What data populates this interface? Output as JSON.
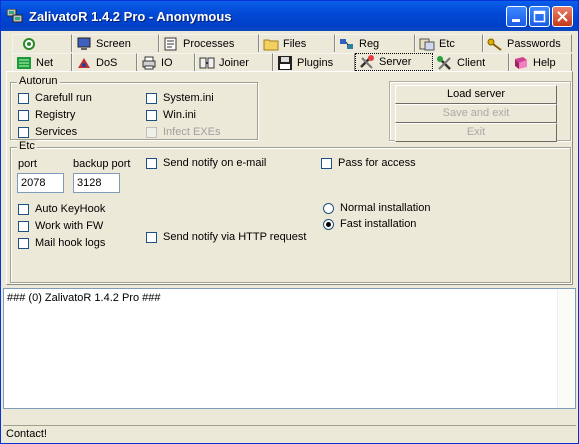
{
  "window": {
    "title": "ZalivatoR 1.4.2 Pro - Anonymous"
  },
  "tabs_row1": [
    {
      "label": "",
      "icon": "target-icon"
    },
    {
      "label": "Screen",
      "icon": "screen-icon"
    },
    {
      "label": "Processes",
      "icon": "processes-icon"
    },
    {
      "label": "Files",
      "icon": "folder-icon"
    },
    {
      "label": "Reg",
      "icon": "registry-icon"
    },
    {
      "label": "Etc",
      "icon": "etc-icon"
    },
    {
      "label": "Passwords",
      "icon": "keys-icon"
    }
  ],
  "tabs_row2": [
    {
      "label": "Net",
      "icon": "net-icon"
    },
    {
      "label": "DoS",
      "icon": "dos-icon"
    },
    {
      "label": "IO",
      "icon": "printer-icon"
    },
    {
      "label": "Joiner",
      "icon": "joiner-icon"
    },
    {
      "label": "Plugins",
      "icon": "floppy-icon"
    },
    {
      "label": "Server",
      "icon": "server-icon",
      "active": true
    },
    {
      "label": "Client",
      "icon": "client-icon"
    },
    {
      "label": "Help",
      "icon": "book-icon"
    }
  ],
  "autorun": {
    "legend": "Autorun",
    "carefull": "Carefull run",
    "registry": "Registry",
    "services": "Services",
    "system_ini": "System.ini",
    "win_ini": "Win.ini",
    "infect": "Infect EXEs"
  },
  "buttons": {
    "load": "Load server",
    "save": "Save and exit",
    "exit": "Exit"
  },
  "etc": {
    "legend": "Etc",
    "port_label": "port",
    "port_value": "2078",
    "backup_label": "backup port",
    "backup_value": "3128",
    "notify_email": "Send notify on e-mail",
    "pass_access": "Pass for access",
    "auto_keyhook": "Auto KeyHook",
    "work_fw": "Work with FW",
    "mail_hook": "Mail hook logs",
    "notify_http": "Send notify via HTTP request",
    "normal_install": "Normal installation",
    "fast_install": "Fast installation"
  },
  "log": {
    "line1": "### (0) ZalivatoR 1.4.2 Pro ###"
  },
  "status": {
    "text": "Contact!"
  }
}
